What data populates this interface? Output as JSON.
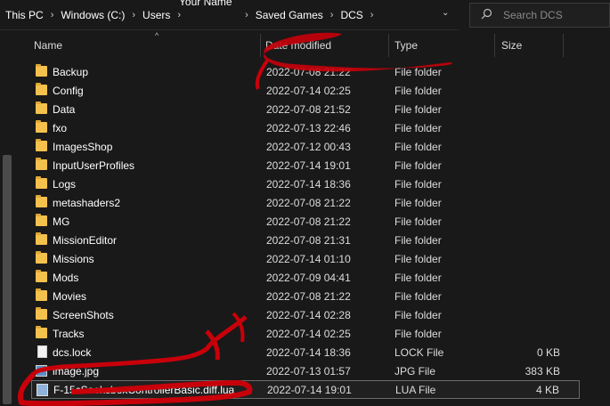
{
  "address": {
    "crumbs": [
      "This PC",
      "Windows (C:)",
      "Users",
      "",
      "Saved Games",
      "DCS"
    ],
    "overlay_name": "Your Name",
    "separator": "›",
    "dropdown": "⌄"
  },
  "search": {
    "placeholder": "Search DCS",
    "icon": "search-icon"
  },
  "columns": {
    "name": "Name",
    "date": "Date modified",
    "type": "Type",
    "size": "Size"
  },
  "rows": [
    {
      "name": "Backup",
      "date": "2022-07-08 21:22",
      "type": "File folder",
      "size": "",
      "icon": "folder-icon"
    },
    {
      "name": "Config",
      "date": "2022-07-14 02:25",
      "type": "File folder",
      "size": "",
      "icon": "folder-icon"
    },
    {
      "name": "Data",
      "date": "2022-07-08 21:52",
      "type": "File folder",
      "size": "",
      "icon": "folder-icon"
    },
    {
      "name": "fxo",
      "date": "2022-07-13 22:46",
      "type": "File folder",
      "size": "",
      "icon": "folder-icon"
    },
    {
      "name": "ImagesShop",
      "date": "2022-07-12 00:43",
      "type": "File folder",
      "size": "",
      "icon": "folder-icon"
    },
    {
      "name": "InputUserProfiles",
      "date": "2022-07-14 19:01",
      "type": "File folder",
      "size": "",
      "icon": "folder-icon"
    },
    {
      "name": "Logs",
      "date": "2022-07-14 18:36",
      "type": "File folder",
      "size": "",
      "icon": "folder-icon"
    },
    {
      "name": "metashaders2",
      "date": "2022-07-08 21:22",
      "type": "File folder",
      "size": "",
      "icon": "folder-icon"
    },
    {
      "name": "MG",
      "date": "2022-07-08 21:22",
      "type": "File folder",
      "size": "",
      "icon": "folder-icon"
    },
    {
      "name": "MissionEditor",
      "date": "2022-07-08 21:31",
      "type": "File folder",
      "size": "",
      "icon": "folder-icon"
    },
    {
      "name": "Missions",
      "date": "2022-07-14 01:10",
      "type": "File folder",
      "size": "",
      "icon": "folder-icon"
    },
    {
      "name": "Mods",
      "date": "2022-07-09 04:41",
      "type": "File folder",
      "size": "",
      "icon": "folder-icon"
    },
    {
      "name": "Movies",
      "date": "2022-07-08 21:22",
      "type": "File folder",
      "size": "",
      "icon": "folder-icon"
    },
    {
      "name": "ScreenShots",
      "date": "2022-07-14 02:28",
      "type": "File folder",
      "size": "",
      "icon": "folder-icon"
    },
    {
      "name": "Tracks",
      "date": "2022-07-14 02:25",
      "type": "File folder",
      "size": "",
      "icon": "folder-icon"
    },
    {
      "name": "dcs.lock",
      "date": "2022-07-14 18:36",
      "type": "LOCK File",
      "size": "0 KB",
      "icon": "file-icon"
    },
    {
      "name": "image.jpg",
      "date": "2022-07-13 01:57",
      "type": "JPG File",
      "size": "383 KB",
      "icon": "image-icon"
    },
    {
      "name": "F-15cSeeksboxControllerBasic.diff.lua",
      "date": "2022-07-14 19:01",
      "type": "LUA File",
      "size": "4 KB",
      "icon": "lua-file-icon",
      "selected": true
    }
  ],
  "colors": {
    "background": "#191919",
    "folder": "#f4c14d",
    "scribble": "#c8000a"
  }
}
